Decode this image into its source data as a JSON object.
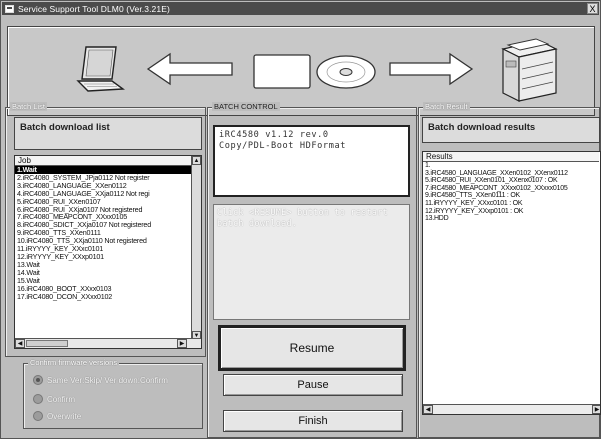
{
  "window": {
    "title": "Service Support Tool DLM0 (Ver.3.21E)",
    "close_label": "X"
  },
  "banner": {
    "icons": [
      "laptop-icon",
      "arrow-left-icon",
      "media-card-icon",
      "disc-icon",
      "arrow-right-icon",
      "copier-icon"
    ]
  },
  "batch_list": {
    "group_label": "Batch List",
    "header": "Batch download list",
    "column": "Job",
    "items": [
      "1.Wait",
      "2.iRC4080_SYSTEM_JPja0112 Not register",
      "3.iRC4080_LANGUAGE_XXen0112",
      "4.iRC4080_LANGUAGE_XXja0112 Not regi",
      "5.iRC4080_RUI_XXen0107",
      "6.iRC4080_RUI_XXja0107 Not registered",
      "7.iRC4080_MEAPCONT_XXxx0105",
      "8.iRC4080_SDICT_XXja0107 Not registered",
      "9.iRC4080_TTS_XXen0111",
      "10.iRC4080_TTS_XXja0110 Not registered",
      "11.iRYYYY_KEY_XXxc0101",
      "12.iRYYYY_KEY_XXxp0101",
      "13.Wait",
      "14.Wait",
      "15.Wait",
      "16.iRC4080_BOOT_XXxx0103",
      "17.iRC4080_DCON_XXxx0102"
    ],
    "selected_index": 0
  },
  "confirm": {
    "group_label": "Confirm firmware versions",
    "options": [
      {
        "label": "Same Ver:Skip/ Ver down:Confirm",
        "selected": true
      },
      {
        "label": "Confirm",
        "selected": false
      },
      {
        "label": "Overwrite",
        "selected": false
      }
    ]
  },
  "batch_control": {
    "group_label": "BATCH CONTROL",
    "info_line1": "iRC4580 v1.12 rev.0",
    "info_line2": "Copy/PDL-Boot HDFormat",
    "message": "Click <RESUME> button to restart batch download.",
    "resume_label": "Resume",
    "pause_label": "Pause",
    "finish_label": "Finish"
  },
  "batch_result": {
    "group_label": "Batch Result",
    "header": "Batch download results",
    "column": "Results",
    "items": [
      "1.",
      "3.iRC4580_LANGUAGE_XXen0102_XXenx0112",
      "5.iRC4580_RUI_XXen0101_XXenx0107 : OK",
      "7.iRC4580_MEAPCONT_XXxx0102_XXxxx0105",
      "9.iRC4580_TTS_XXen0111 : OK",
      "11.iRYYYY_KEY_XXxc0101 : OK",
      "12.iRYYYY_KEY_XXxp0101 : OK",
      "13.HDD"
    ]
  },
  "colors": {
    "window_bg": "#bdbdbd",
    "titlebar_bg": "#4b4b4b",
    "panel_white": "#ffffff"
  }
}
